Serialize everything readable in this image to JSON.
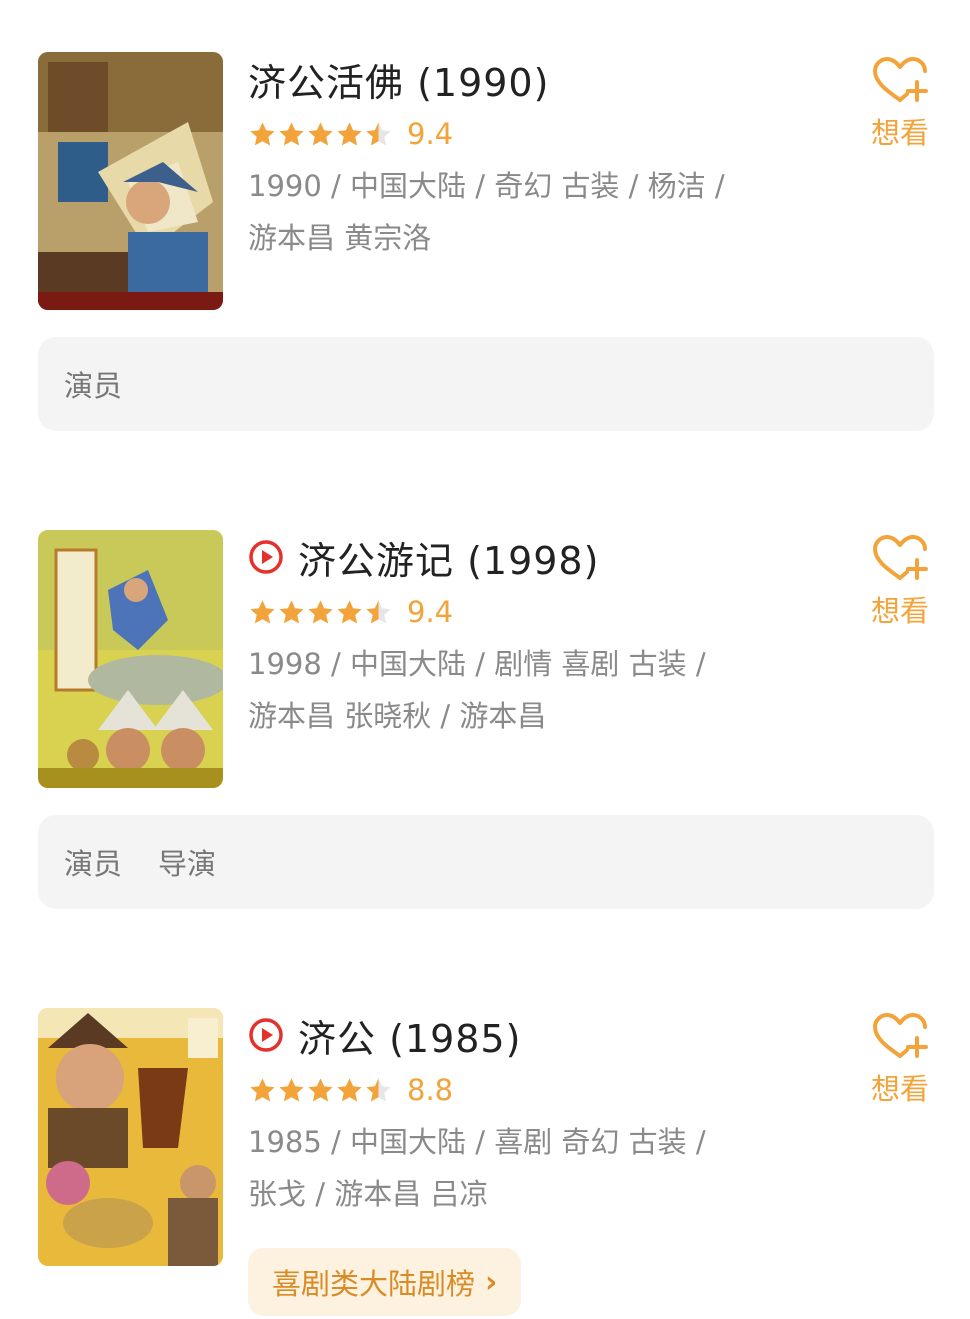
{
  "accent_color": "#f2a33a",
  "movies": [
    {
      "title": "济公活佛 (1990)",
      "has_play": false,
      "stars": 4.5,
      "score": "9.4",
      "meta_line1": "1990 / 中国大陆 / 奇幻 古装 / 杨洁 /",
      "meta_line2": "游本昌 黄宗洛",
      "want_label": "想看",
      "poster_icon": "poster-image",
      "credits": [
        "演员"
      ]
    },
    {
      "title": "济公游记 (1998)",
      "has_play": true,
      "stars": 4.5,
      "score": "9.4",
      "meta_line1": "1998 / 中国大陆 / 剧情 喜剧 古装 /",
      "meta_line2": "游本昌 张晓秋 / 游本昌",
      "want_label": "想看",
      "poster_icon": "poster-image",
      "credits": [
        "演员",
        "导演"
      ]
    },
    {
      "title": "济公 (1985)",
      "has_play": true,
      "stars": 4.5,
      "score": "8.8",
      "meta_line1": "1985 / 中国大陆 / 喜剧 奇幻 古装 /",
      "meta_line2": "张戈 / 游本昌 吕凉",
      "want_label": "想看",
      "poster_icon": "poster-image",
      "rank_label": "喜剧类大陆剧榜",
      "rank_arrow": "›"
    }
  ]
}
